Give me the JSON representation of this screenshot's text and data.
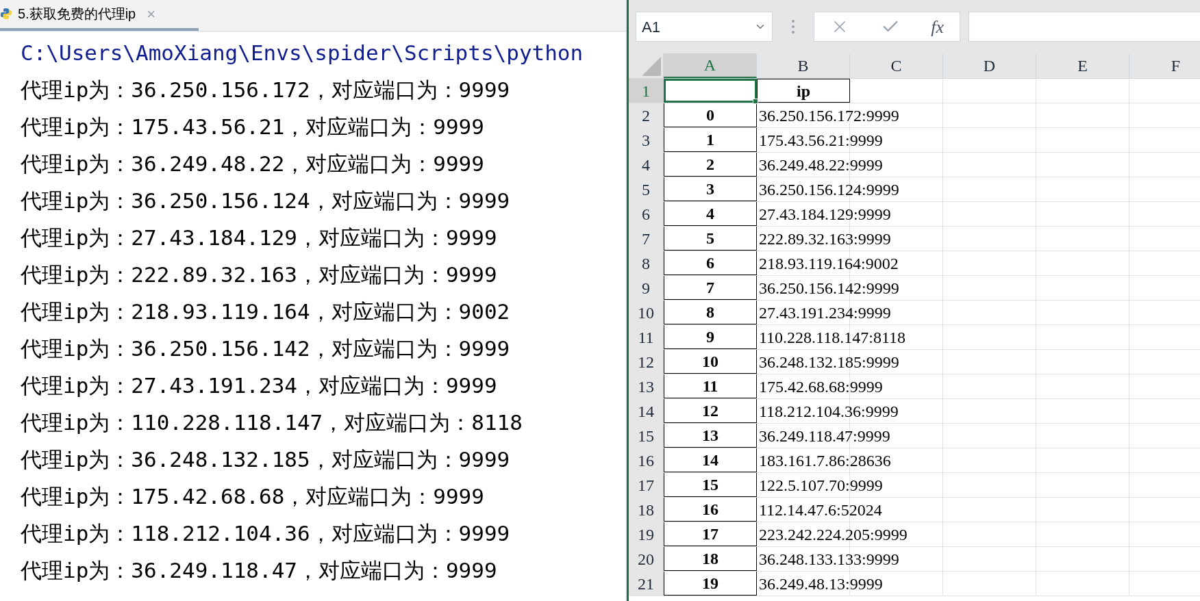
{
  "console_tab": {
    "title": "5.获取免费的代理ip",
    "close": "×"
  },
  "console": {
    "command": "C:\\Users\\AmoXiang\\Envs\\spider\\Scripts\\python",
    "lines": [
      "代理ip为：36.250.156.172，对应端口为：9999",
      "代理ip为：175.43.56.21，对应端口为：9999",
      "代理ip为：36.249.48.22，对应端口为：9999",
      "代理ip为：36.250.156.124，对应端口为：9999",
      "代理ip为：27.43.184.129，对应端口为：9999",
      "代理ip为：222.89.32.163，对应端口为：9999",
      "代理ip为：218.93.119.164，对应端口为：9002",
      "代理ip为：36.250.156.142，对应端口为：9999",
      "代理ip为：27.43.191.234，对应端口为：9999",
      "代理ip为：110.228.118.147，对应端口为：8118",
      "代理ip为：36.248.132.185，对应端口为：9999",
      "代理ip为：175.42.68.68，对应端口为：9999",
      "代理ip为：118.212.104.36，对应端口为：9999",
      "代理ip为：36.249.118.47，对应端口为：9999"
    ]
  },
  "spreadsheet": {
    "name_box": "A1",
    "function_label": "fx",
    "columns": [
      {
        "label": "A",
        "selected": true
      },
      {
        "label": "B",
        "selected": false
      },
      {
        "label": "C",
        "selected": false
      },
      {
        "label": "D",
        "selected": false
      },
      {
        "label": "E",
        "selected": false
      },
      {
        "label": "F",
        "selected": false
      }
    ],
    "rows": [
      {
        "number": "1",
        "selected": true,
        "b": "ip"
      },
      {
        "number": "2",
        "selected": false,
        "a": "0",
        "b": "36.250.156.172:9999"
      },
      {
        "number": "3",
        "selected": false,
        "a": "1",
        "b": "175.43.56.21:9999"
      },
      {
        "number": "4",
        "selected": false,
        "a": "2",
        "b": "36.249.48.22:9999"
      },
      {
        "number": "5",
        "selected": false,
        "a": "3",
        "b": "36.250.156.124:9999"
      },
      {
        "number": "6",
        "selected": false,
        "a": "4",
        "b": "27.43.184.129:9999"
      },
      {
        "number": "7",
        "selected": false,
        "a": "5",
        "b": "222.89.32.163:9999"
      },
      {
        "number": "8",
        "selected": false,
        "a": "6",
        "b": "218.93.119.164:9002"
      },
      {
        "number": "9",
        "selected": false,
        "a": "7",
        "b": "36.250.156.142:9999"
      },
      {
        "number": "10",
        "selected": false,
        "a": "8",
        "b": "27.43.191.234:9999"
      },
      {
        "number": "11",
        "selected": false,
        "a": "9",
        "b": "110.228.118.147:8118"
      },
      {
        "number": "12",
        "selected": false,
        "a": "10",
        "b": "36.248.132.185:9999"
      },
      {
        "number": "13",
        "selected": false,
        "a": "11",
        "b": "175.42.68.68:9999"
      },
      {
        "number": "14",
        "selected": false,
        "a": "12",
        "b": "118.212.104.36:9999"
      },
      {
        "number": "15",
        "selected": false,
        "a": "13",
        "b": "36.249.118.47:9999"
      },
      {
        "number": "16",
        "selected": false,
        "a": "14",
        "b": "183.161.7.86:28636"
      },
      {
        "number": "17",
        "selected": false,
        "a": "15",
        "b": "122.5.107.70:9999"
      },
      {
        "number": "18",
        "selected": false,
        "a": "16",
        "b": "112.14.47.6:52024"
      },
      {
        "number": "19",
        "selected": false,
        "a": "17",
        "b": "223.242.224.205:9999"
      },
      {
        "number": "20",
        "selected": false,
        "a": "18",
        "b": "36.248.133.133:9999"
      },
      {
        "number": "21",
        "selected": false,
        "a": "19",
        "b": "36.249.48.13:9999"
      }
    ]
  }
}
